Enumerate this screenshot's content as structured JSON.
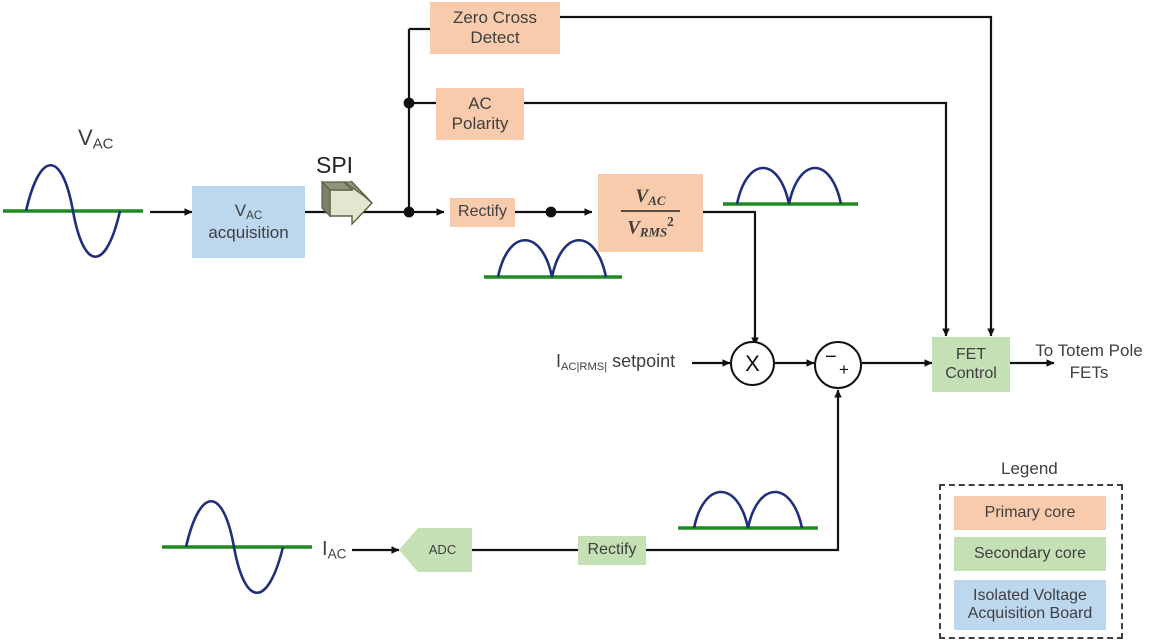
{
  "diagram": {
    "title_hidden": "",
    "blocks": {
      "vac_acquisition": {
        "line1": "V",
        "sub1": "AC",
        "line2": "acquisition"
      },
      "zero_cross": {
        "line1": "Zero Cross",
        "line2": "Detect"
      },
      "ac_polarity": {
        "line1": "AC",
        "line2": "Polarity"
      },
      "rectify_top": {
        "label": "Rectify"
      },
      "transfer_fn": {
        "numerator": "V",
        "numerator_sub": "AC",
        "denominator": "V",
        "denominator_sub": "RMS",
        "exponent": "2"
      },
      "fet_control": {
        "line1": "FET",
        "line2": "Control"
      },
      "adc": {
        "label": "ADC"
      },
      "rectify_bottom": {
        "label": "Rectify"
      }
    },
    "labels": {
      "vac_source": "V",
      "vac_source_sub": "AC",
      "spi": "SPI",
      "iac_setpoint_main": "I",
      "iac_setpoint_sub": "AC|RMS|",
      "iac_setpoint_tail": " setpoint",
      "iac_source": "I",
      "iac_source_sub": "AC",
      "output_line1": "To Totem Pole",
      "output_line2": "FETs"
    },
    "operators": {
      "multiply": "X",
      "sum_minus": "−",
      "sum_plus": "+"
    },
    "legend": {
      "title": "Legend",
      "items": [
        {
          "label": "Primary core",
          "color": "#f8cbad",
          "kind": "primary"
        },
        {
          "label": "Secondary core",
          "color": "#c5e0b4",
          "kind": "secondary"
        },
        {
          "label": "Isolated Voltage\nAcquisition Board",
          "line1": "Isolated Voltage",
          "line2": "Acquisition Board",
          "color": "#bdd7ee",
          "kind": "isolated"
        }
      ]
    },
    "colors": {
      "primary_core": "#f8cbad",
      "secondary_core": "#c5e0b4",
      "isolated_board": "#bdd7ee",
      "wire": "#111111",
      "waveform": "#1f2f7a",
      "axis": "#1f8a1f",
      "spi_arrow": "#e2e8cf",
      "spi_arrow_side": "#7c8168"
    },
    "waveforms": [
      {
        "name": "vac-input-sine",
        "type": "sine"
      },
      {
        "name": "iac-input-sine",
        "type": "sine"
      },
      {
        "name": "rectified-vac",
        "type": "rectified"
      },
      {
        "name": "normalized-rectified-vac",
        "type": "rectified"
      },
      {
        "name": "rectified-iac",
        "type": "rectified"
      }
    ]
  }
}
